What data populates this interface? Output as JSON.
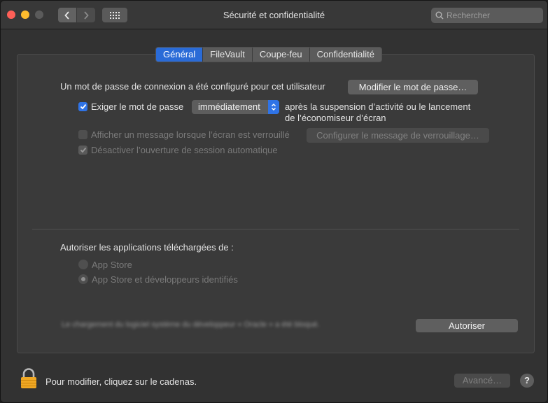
{
  "window": {
    "title": "Sécurité et confidentialité"
  },
  "search": {
    "placeholder": "Rechercher"
  },
  "tabs": [
    "Général",
    "FileVault",
    "Coupe-feu",
    "Confidentialité"
  ],
  "general": {
    "password_text": "Un mot de passe de connexion a été configuré pour cet utilisateur",
    "change_password_button": "Modifier le mot de passe…",
    "require_password": {
      "label": "Exiger le mot de passe",
      "checked": true,
      "popup_value": "immédiatement",
      "after_line1": "après la suspension d’activité ou le lancement",
      "after_line2": "de l’économiseur d’écran"
    },
    "show_message": {
      "label": "Afficher un message lorsque l’écran est verrouillé",
      "checked": false,
      "button": "Configurer le message de verrouillage…"
    },
    "disable_autologin": {
      "label": "Désactiver l’ouverture de session automatique",
      "checked": true
    }
  },
  "downloads": {
    "heading": "Autoriser les applications téléchargées de :",
    "options": [
      "App Store",
      "App Store et développeurs identifiés"
    ],
    "selected": "App Store et développeurs identifiés",
    "blurred_message": "Le chargement du logiciel système du développeur « Oracle » a été bloqué.",
    "allow_button": "Autoriser"
  },
  "footer": {
    "lock_text": "Pour modifier, cliquez sur le cadenas.",
    "advanced_button": "Avancé…",
    "help": "?"
  },
  "colors": {
    "accent": "#2f73e6"
  }
}
